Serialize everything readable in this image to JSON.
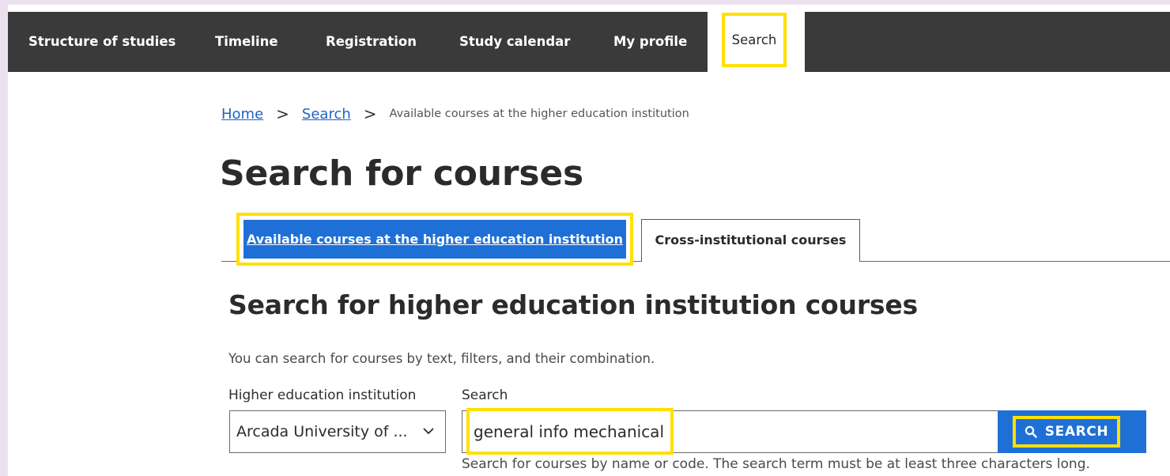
{
  "nav": {
    "items": [
      {
        "label": "Structure of studies"
      },
      {
        "label": "Timeline"
      },
      {
        "label": "Registration"
      },
      {
        "label": "Study calendar"
      },
      {
        "label": "My profile"
      },
      {
        "label": "Search",
        "active": true
      }
    ]
  },
  "breadcrumb": {
    "home": "Home",
    "search": "Search",
    "separator": ">",
    "current": "Available courses at the higher education institution"
  },
  "page": {
    "title": "Search for courses"
  },
  "tabs": [
    {
      "label": "Available courses at the higher education institution",
      "active": true
    },
    {
      "label": "Cross-institutional courses",
      "active": false
    }
  ],
  "section": {
    "title": "Search for higher education institution courses",
    "description": "You can search for courses by text, filters, and their combination."
  },
  "form": {
    "institution_label": "Higher education institution",
    "institution_value": "Arcada University of ...",
    "search_label": "Search",
    "search_value": "general info mechanical",
    "search_button_label": "SEARCH",
    "search_help": "Search for courses by name or code. The search term must be at least three characters long."
  },
  "icons": {
    "select": "chevron-down-icon",
    "search_button": "search-icon"
  },
  "colors": {
    "nav_background": "#3a3a3a",
    "accent_blue": "#1f70d6",
    "link_blue": "#1e62c4",
    "highlight_yellow": "#ffe000",
    "page_background": "#ece2ef"
  }
}
